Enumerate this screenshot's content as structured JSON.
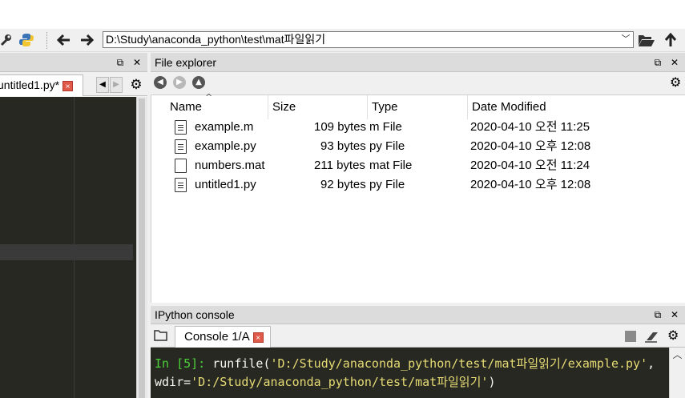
{
  "toolbar": {
    "path": "D:\\Study\\anaconda_python\\test\\mat파일읽기",
    "icons": [
      "wrench-icon",
      "python-icon",
      "back-arrow-icon",
      "forward-arrow-icon",
      "folder-open-icon",
      "up-arrow-icon"
    ]
  },
  "editor": {
    "tab_label": "untitled1.py*",
    "close_glyph": "×",
    "tab_left": "◀",
    "tab_right": "▶"
  },
  "file_explorer": {
    "title": "File explorer",
    "controls": "⧉ ✕",
    "columns": [
      "Name",
      "Size",
      "Type",
      "Date Modified"
    ],
    "files": [
      {
        "name": "example.m",
        "size": "109 bytes",
        "type": "m File",
        "date": "2020-04-10 오전 11:25"
      },
      {
        "name": "example.py",
        "size": "93 bytes",
        "type": "py File",
        "date": "2020-04-10 오후 12:08"
      },
      {
        "name": "numbers.mat",
        "size": "211 bytes",
        "type": "mat File",
        "date": "2020-04-10 오전 11:24"
      },
      {
        "name": "untitled1.py",
        "size": "92 bytes",
        "type": "py File",
        "date": "2020-04-10 오후 12:08"
      }
    ]
  },
  "console": {
    "title": "IPython console",
    "controls": "⧉ ✕",
    "tab_label": "Console 1/A",
    "close_glyph": "×",
    "prompt": "In [5]:",
    "command": " runfile(",
    "arg1": "'D:/Study/anaconda_python/test/mat파일읽기/example.py'",
    "sep": ",",
    "line2_prefix": "wdir=",
    "arg2": "'D:/Study/anaconda_python/test/mat파일읽기'",
    "line2_suffix": ")"
  },
  "colors": {
    "editor_bg": "#272822",
    "prompt_green": "#4cd03a",
    "string_yellow": "#e6db74",
    "close_red": "#e05a4a"
  }
}
